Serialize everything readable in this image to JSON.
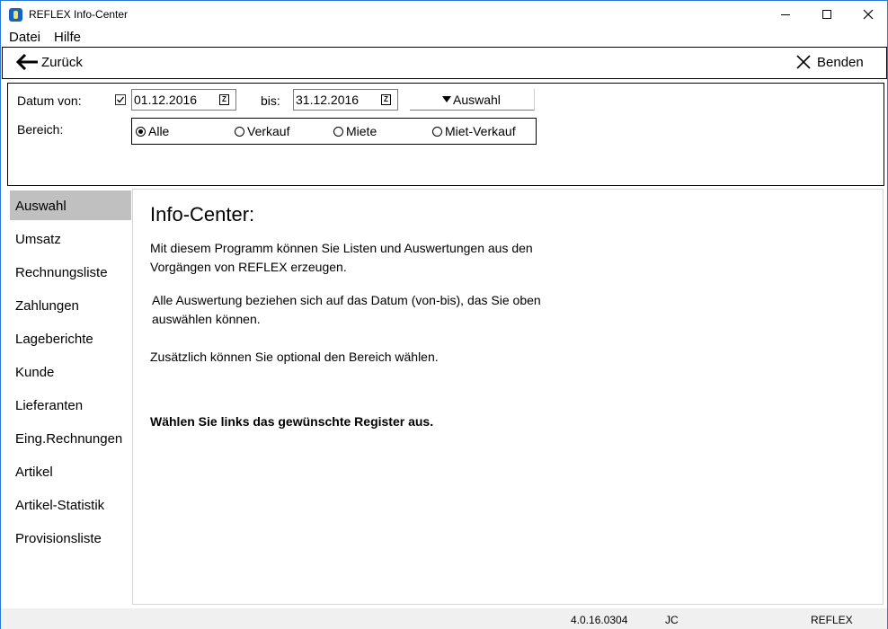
{
  "window": {
    "title": "REFLEX Info-Center"
  },
  "menu": {
    "datei": "Datei",
    "hilfe": "Hilfe"
  },
  "nav": {
    "back_label": "Zurück",
    "end_label": "Benden"
  },
  "filter": {
    "datum_von_label": "Datum von:",
    "date_from_checked": true,
    "date_from": "01.12.2016",
    "bis_label": "bis:",
    "date_to": "31.12.2016",
    "auswahl_label": "Auswahl",
    "bereich_label": "Bereich:",
    "bereich_options": [
      "Alle",
      "Verkauf",
      "Miete",
      "Miet-Verkauf"
    ],
    "bereich_selected": "Alle"
  },
  "sidebar": {
    "items": [
      {
        "label": "Auswahl",
        "active": true
      },
      {
        "label": "Umsatz"
      },
      {
        "label": "Rechnungsliste"
      },
      {
        "label": "Zahlungen"
      },
      {
        "label": "Lageberichte"
      },
      {
        "label": "Kunde"
      },
      {
        "label": "Lieferanten"
      },
      {
        "label": "Eing.Rechnungen"
      },
      {
        "label": "Artikel"
      },
      {
        "label": "Artikel-Statistik"
      },
      {
        "label": "Provisionsliste"
      }
    ]
  },
  "content": {
    "title": "Info-Center:",
    "paragraph1": "Mit diesem Programm können Sie Listen und Auswertungen aus den Vorgängen von REFLEX erzeugen.",
    "paragraph2": "Alle Auswertung beziehen sich auf das Datum (von-bis), das Sie oben auswählen können.",
    "paragraph3": "Zusätzlich können Sie optional den Bereich wählen.",
    "paragraph4": "Wählen Sie links das gewünschte Register aus."
  },
  "status": {
    "version": "4.0.16.0304",
    "user": "JC",
    "app": "REFLEX"
  },
  "colors": {
    "window_border": "#2b79d6",
    "active_tab": "#c0c0c0",
    "statusbar": "#f0f0f0"
  }
}
